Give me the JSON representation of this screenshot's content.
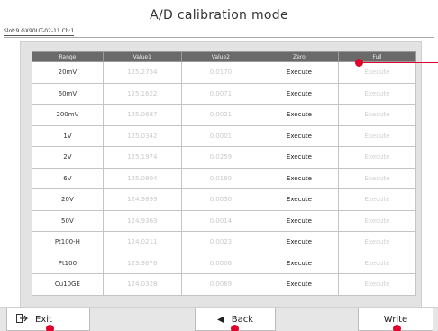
{
  "title": "A/D calibration mode",
  "slot_info": "Slot:9  GX90UT-02-11  Ch:1",
  "table": {
    "headers": [
      "Range",
      "Value1",
      "Value2",
      "Zero",
      "Full"
    ],
    "rows": [
      {
        "range": "20mV",
        "value1": "125.2754",
        "value2": "0.0170",
        "zero": "Execute",
        "full": "Execute"
      },
      {
        "range": "60mV",
        "value1": "125.1622",
        "value2": "0.0071",
        "zero": "Execute",
        "full": "Execute"
      },
      {
        "range": "200mV",
        "value1": "125.0687",
        "value2": "0.0021",
        "zero": "Execute",
        "full": "Execute"
      },
      {
        "range": "1V",
        "value1": "125.0342",
        "value2": "0.0001",
        "zero": "Execute",
        "full": "Execute"
      },
      {
        "range": "2V",
        "value1": "125.1974",
        "value2": "0.0259",
        "zero": "Execute",
        "full": "Execute"
      },
      {
        "range": "6V",
        "value1": "125.0804",
        "value2": "0.0180",
        "zero": "Execute",
        "full": "Execute"
      },
      {
        "range": "20V",
        "value1": "124.9899",
        "value2": "0.0030",
        "zero": "Execute",
        "full": "Execute"
      },
      {
        "range": "50V",
        "value1": "124.9363",
        "value2": "0.0014",
        "zero": "Execute",
        "full": "Execute"
      },
      {
        "range": "Pt100-H",
        "value1": "124.0211",
        "value2": "0.0023",
        "zero": "Execute",
        "full": "Execute"
      },
      {
        "range": "Pt100",
        "value1": "123.9676",
        "value2": "0.0006",
        "zero": "Execute",
        "full": "Execute"
      },
      {
        "range": "Cu10GE",
        "value1": "124.0328",
        "value2": "0.0069",
        "zero": "Execute",
        "full": "Execute"
      }
    ]
  },
  "buttons": {
    "exit": "Exit",
    "back": "Back",
    "write": "Write"
  },
  "icons": {
    "exit": "exit-arrow-icon",
    "back": "triangle-left-icon"
  },
  "colors": {
    "header_bg": "#6a6a6a",
    "callout": "#e0002b"
  }
}
